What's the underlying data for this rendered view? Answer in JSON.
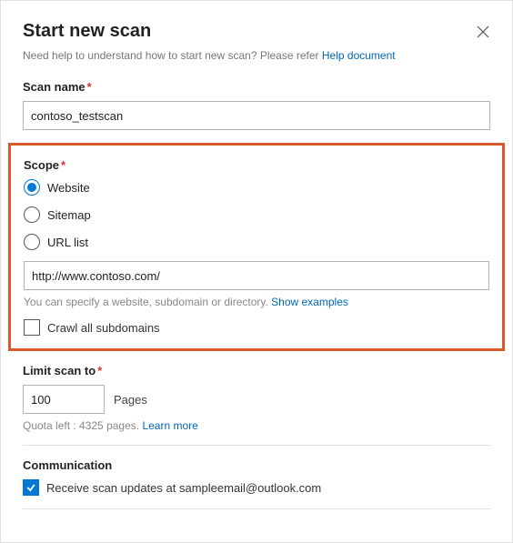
{
  "header": {
    "title": "Start new scan"
  },
  "help": {
    "prefix": "Need help to understand how to start new scan? Please refer ",
    "link": "Help document"
  },
  "scanName": {
    "label": "Scan name",
    "value": "contoso_testscan"
  },
  "scope": {
    "label": "Scope",
    "options": [
      {
        "label": "Website",
        "checked": true
      },
      {
        "label": "Sitemap",
        "checked": false
      },
      {
        "label": "URL list",
        "checked": false
      }
    ],
    "url": "http://www.contoso.com/",
    "hintPrefix": "You can specify a website, subdomain or directory. ",
    "hintLink": "Show examples",
    "crawlAll": {
      "label": "Crawl all subdomains",
      "checked": false
    }
  },
  "limit": {
    "label": "Limit scan to",
    "value": "100",
    "unit": "Pages",
    "quotaPrefix": "Quota left : 4325 pages. ",
    "quotaLink": "Learn more"
  },
  "communication": {
    "label": "Communication",
    "receive": {
      "label": "Receive scan updates at sampleemail@outlook.com",
      "checked": true
    }
  }
}
